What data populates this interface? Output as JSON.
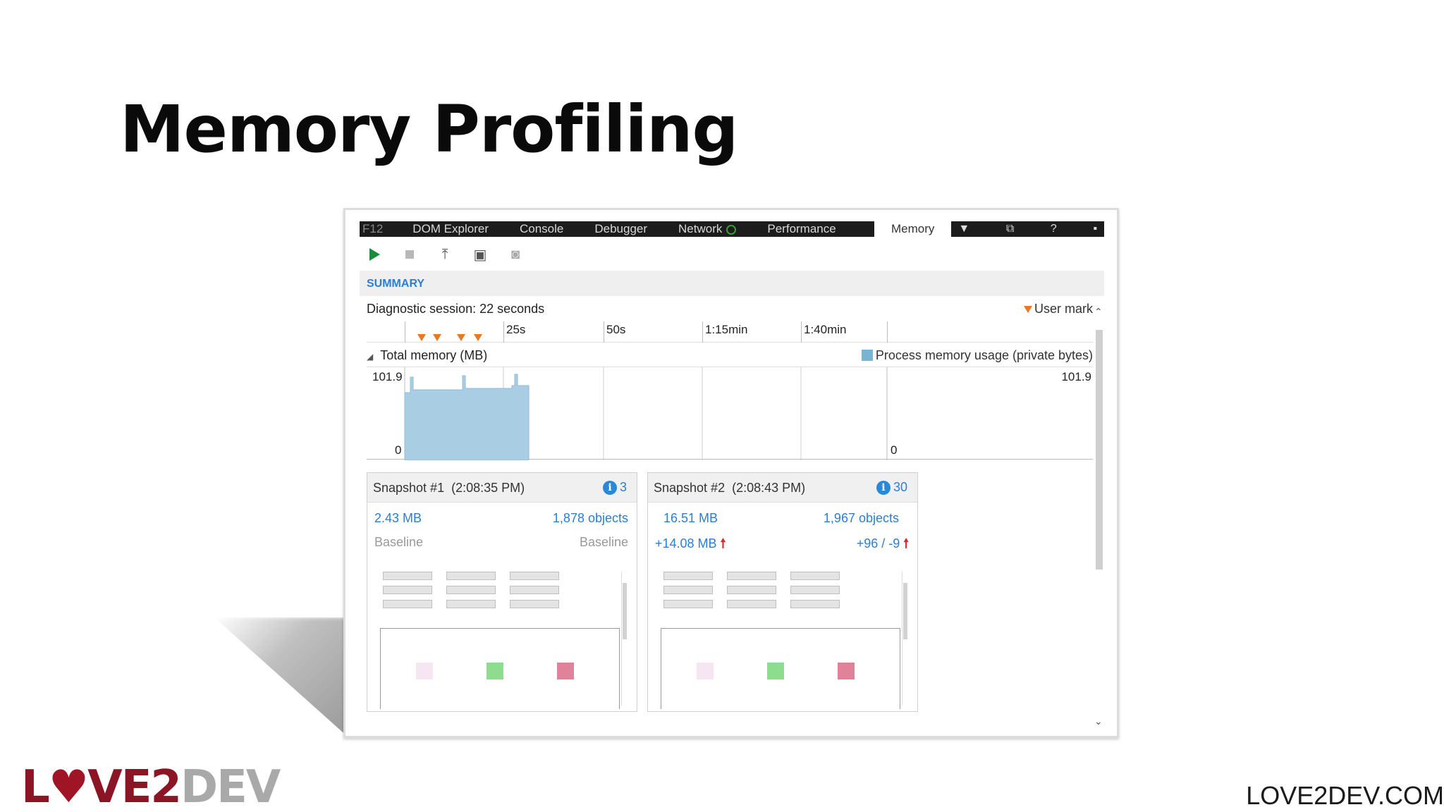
{
  "slide": {
    "title": "Memory Profiling",
    "site_url": "LOVE2DEV.COM",
    "logo": {
      "part1": "L",
      "heart": "♥",
      "part2": "VE2",
      "part3": "DEV"
    }
  },
  "devtools": {
    "tabs": [
      {
        "label": "F12"
      },
      {
        "label": "DOM Explorer"
      },
      {
        "label": "Console"
      },
      {
        "label": "Debugger"
      },
      {
        "label": "Network"
      },
      {
        "label": "Performance"
      },
      {
        "label": "Memory"
      }
    ],
    "summary_label": "SUMMARY",
    "session_label": "Diagnostic session: 22 seconds",
    "user_mark_label": "User mark",
    "ruler_ticks": [
      "25s",
      "50s",
      "1:15min",
      "1:40min"
    ],
    "memory_header": "Total memory (MB)",
    "legend_label": "Process memory usage (private bytes)",
    "y_max": "101.9",
    "y_min": "0",
    "accent_color": "#2a7fd4",
    "chart_fill_color": "#a9cde3"
  },
  "snapshots": [
    {
      "title": "Snapshot #1",
      "time": "(2:08:35 PM)",
      "badge_count": "3",
      "size": "2.43 MB",
      "objects": "1,878 objects",
      "size_diff": "Baseline",
      "objects_diff": "Baseline",
      "has_diff": false
    },
    {
      "title": "Snapshot #2",
      "time": "(2:08:43 PM)",
      "badge_count": "30",
      "size": "16.51 MB",
      "objects": "1,967 objects",
      "size_diff": "+14.08 MB",
      "objects_diff": "+96 / -9",
      "has_diff": true
    }
  ]
}
